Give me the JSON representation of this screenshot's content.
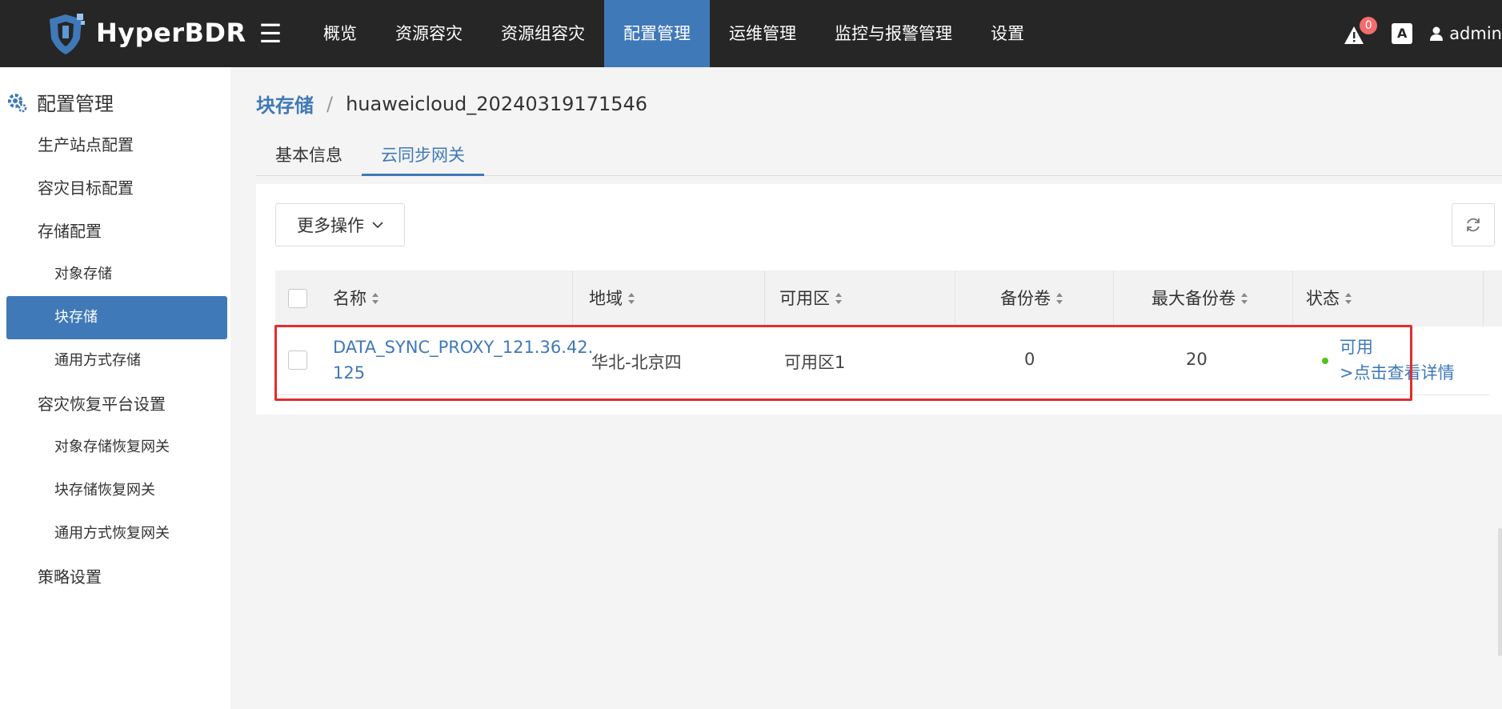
{
  "app": {
    "brand": "HyperBDR"
  },
  "topbar": {
    "nav": [
      "概览",
      "资源容灾",
      "资源组容灾",
      "配置管理",
      "运维管理",
      "监控与报警管理",
      "设置"
    ],
    "alert_count": "0",
    "lang_label": "A",
    "username": "admin",
    "accent_color": "#3f79b8"
  },
  "sidebar": {
    "title": "配置管理",
    "items": [
      {
        "label": "生产站点配置"
      },
      {
        "label": "容灾目标配置"
      },
      {
        "label": "存储配置"
      },
      {
        "label": "对象存储"
      },
      {
        "label": "块存储"
      },
      {
        "label": "通用方式存储"
      },
      {
        "label": "容灾恢复平台设置"
      },
      {
        "label": "对象存储恢复网关"
      },
      {
        "label": "块存储恢复网关"
      },
      {
        "label": "通用方式恢复网关"
      },
      {
        "label": "策略设置"
      }
    ]
  },
  "breadcrumb": {
    "parent": "块存储",
    "separator": "/",
    "current": "huaweicloud_20240319171546"
  },
  "tabs": [
    {
      "label": "基本信息",
      "active": false
    },
    {
      "label": "云同步网关",
      "active": true
    }
  ],
  "toolbar": {
    "more_label": "更多操作"
  },
  "table": {
    "columns": [
      "名称",
      "地域",
      "可用区",
      "备份卷",
      "最大备份卷",
      "状态"
    ],
    "rows": [
      {
        "name_line1": "DATA_SYNC_PROXY_121.36.42.",
        "name_line2": "125",
        "region": "华北-北京四",
        "zone": "可用区1",
        "backup_volumes": "0",
        "max_backup_volumes": "20",
        "status": "可用",
        "detail_link": ">点击查看详情"
      }
    ]
  },
  "colors": {
    "status_ok": "#52c41a",
    "highlight": "#e22d2d"
  }
}
